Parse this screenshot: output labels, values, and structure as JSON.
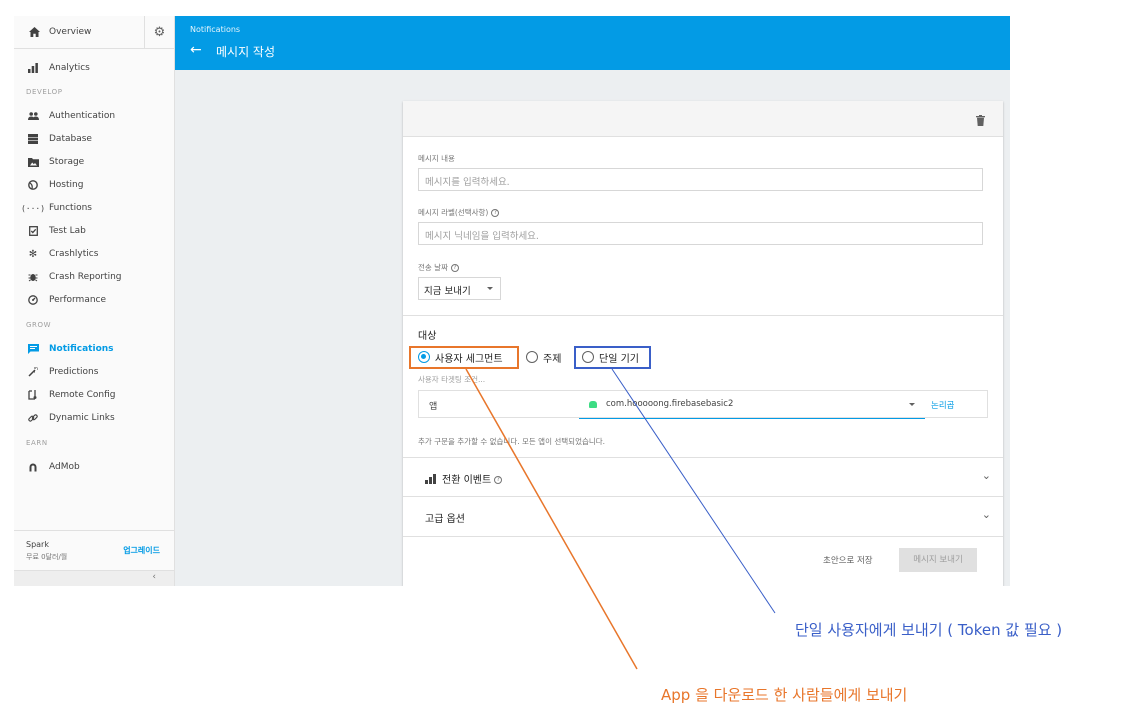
{
  "sidebar": {
    "overview": "Overview",
    "analytics": "Analytics",
    "sections": {
      "develop": "DEVELOP",
      "grow": "GROW",
      "earn": "EARN"
    },
    "develop_items": [
      {
        "label": "Authentication",
        "icon": "people-icon"
      },
      {
        "label": "Database",
        "icon": "database-icon"
      },
      {
        "label": "Storage",
        "icon": "folder-image-icon"
      },
      {
        "label": "Hosting",
        "icon": "globe-icon"
      },
      {
        "label": "Functions",
        "icon": "functions-icon"
      },
      {
        "label": "Test Lab",
        "icon": "checklist-icon"
      },
      {
        "label": "Crashlytics",
        "icon": "gear-cluster-icon"
      },
      {
        "label": "Crash Reporting",
        "icon": "bug-icon"
      },
      {
        "label": "Performance",
        "icon": "speedometer-icon"
      }
    ],
    "grow_items": [
      {
        "label": "Notifications",
        "icon": "message-icon",
        "active": true
      },
      {
        "label": "Predictions",
        "icon": "magic-wand-icon"
      },
      {
        "label": "Remote Config",
        "icon": "remote-config-icon"
      },
      {
        "label": "Dynamic Links",
        "icon": "link-icon"
      }
    ],
    "earn_items": [
      {
        "label": "AdMob",
        "icon": "admob-icon"
      }
    ],
    "plan": {
      "name": "Spark",
      "desc": "무료 0달러/월",
      "upgrade": "업그레이드"
    }
  },
  "header": {
    "breadcrumb": "Notifications",
    "title": "메시지 작성",
    "back_icon": "arrow-back-icon"
  },
  "form": {
    "message_label": "메시지 내용",
    "message_placeholder": "메시지를 입력하세요.",
    "nickname_label": "메시지 라벨(선택사항)",
    "nickname_placeholder": "메시지 닉네임을 입력하세요.",
    "date_label": "전송 날짜",
    "date_value": "지금 보내기",
    "target_title": "대상",
    "targets": [
      "사용자 세그먼트",
      "주제",
      "단일 기기"
    ],
    "target_selected": "사용자 세그먼트",
    "target_condition_label": "사용자 타겟팅 조건...",
    "condition_field": "앱",
    "condition_value": "com.hooooong.firebasebasic2",
    "condition_logic": "논리곱",
    "note": "추가 구문을 추가할 수 없습니다. 모든 앱이 선택되었습니다.",
    "conversion_events": "전환 이벤트",
    "advanced_options": "고급 옵션",
    "save_draft": "초안으로 저장",
    "send_message": "메시지 보내기"
  },
  "annotations": {
    "single_device": "단일 사용자에게 보내기 ( Token 값 필요 )",
    "segment": "App 을 다운로드 한 사람들에게 보내기",
    "colors": {
      "orange": "#e8762b",
      "blue": "#3a5fc8"
    }
  }
}
